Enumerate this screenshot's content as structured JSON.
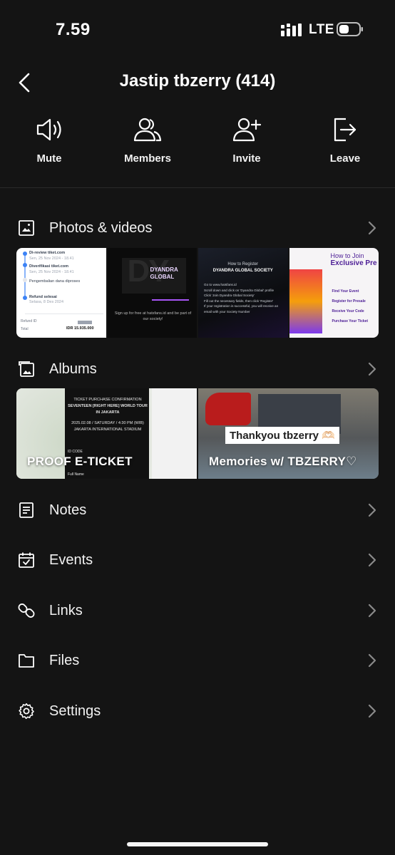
{
  "status": {
    "time": "7.59",
    "network": "LTE"
  },
  "header": {
    "title": "Jastip tbzerry (414)"
  },
  "actions": [
    {
      "label": "Mute",
      "icon": "speaker-icon"
    },
    {
      "label": "Members",
      "icon": "members-icon"
    },
    {
      "label": "Invite",
      "icon": "add-person-icon"
    },
    {
      "label": "Leave",
      "icon": "leave-icon"
    }
  ],
  "sections": {
    "photos": {
      "label": "Photos & videos"
    },
    "albums": {
      "label": "Albums"
    },
    "notes": {
      "label": "Notes"
    },
    "events": {
      "label": "Events"
    },
    "links": {
      "label": "Links"
    },
    "files": {
      "label": "Files"
    },
    "settings": {
      "label": "Settings"
    }
  },
  "photo_thumbs": [
    {
      "lines": [
        "Di-review tiket.com",
        "Sen, 25 Nov 2024 - 18.41",
        "Diverifikasi tiket.com",
        "Sen, 25 Nov 2024 - 18.41",
        "Pengembalian dana diproses",
        "Refund selesai",
        "Selasa, 8 Des 2024",
        "Refund ID",
        "Total",
        "IDR 15.935.000"
      ]
    },
    {
      "brand": "DYANDRA GLOBAL",
      "caption": "Sign up for free at hatsfans.id and be part of our society!"
    },
    {
      "title": "How to Register",
      "subtitle": "DYANDRA GLOBAL SOCIETY",
      "steps": [
        "Go to www.hatsfans.id",
        "Scroll down and click on 'Dyandra Global' profile",
        "Click 'Join Dyandra Global Society'",
        "Fill out the necessary fields, then click 'Register'",
        "If your registration is successful, you will receive an email with your Society Number"
      ]
    },
    {
      "title": "How to Join",
      "subtitle": "Exclusive Pre",
      "steps": [
        "Find Your Event",
        "Register for Presale",
        "Receive Your Code",
        "Purchase Your Ticket"
      ]
    }
  ],
  "albums": [
    {
      "label": "PROOF E-TICKET",
      "ticket_lines": [
        "TICKET PURCHASE CONFIRMATION",
        "SEVENTEEN [RIGHT HERE] WORLD TOUR IN JAKARTA",
        "2025.02.08 / SATURDAY / 4:30 PM (WIB)",
        "JAKARTA INTERNATIONAL STADIUM",
        "ID CODE",
        "Full Name"
      ]
    },
    {
      "label": "Memories w/ TBZERRY♡",
      "banner": "Thankyou tbzerry 🫶🏻"
    }
  ],
  "colors": {
    "background": "#141414",
    "text": "#ffffff",
    "chevron": "#8a8a8a",
    "divider": "#2a2a2a"
  }
}
